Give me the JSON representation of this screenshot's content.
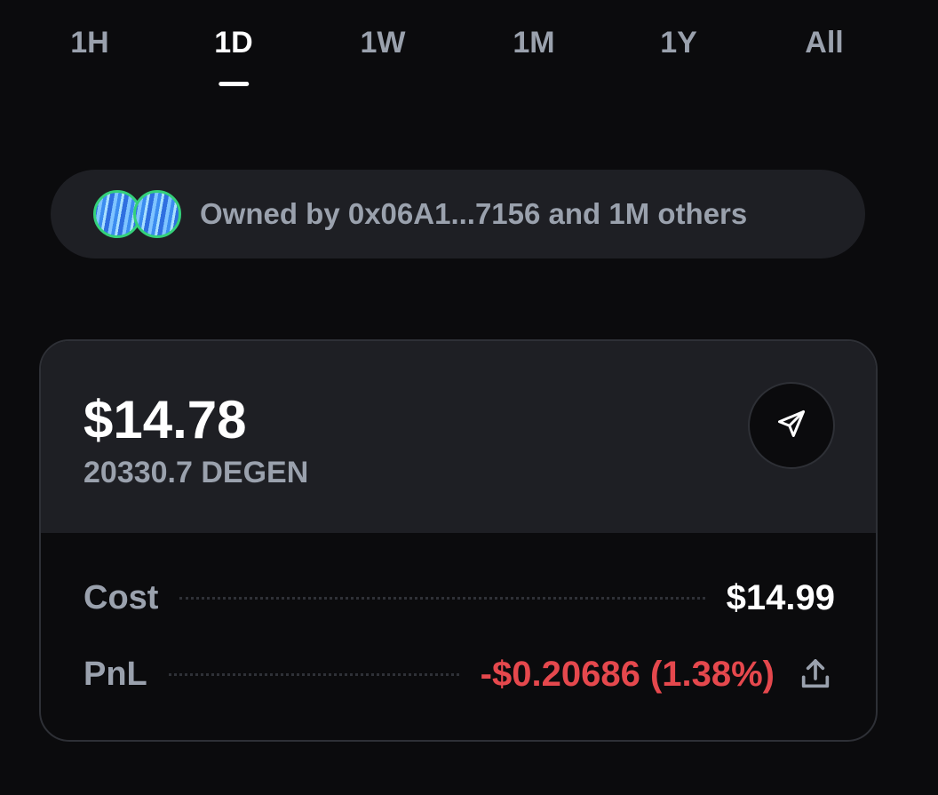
{
  "timeframes": {
    "tabs": [
      {
        "label": "1H"
      },
      {
        "label": "1D"
      },
      {
        "label": "1W"
      },
      {
        "label": "1M"
      },
      {
        "label": "1Y"
      },
      {
        "label": "All"
      }
    ],
    "selected": "1D"
  },
  "owners": {
    "text": "Owned by 0x06A1...7156 and 1M others",
    "avatar_icon": "token-holder-avatar"
  },
  "position": {
    "balance_usd": "$14.78",
    "balance_token": "20330.7 DEGEN",
    "send_icon": "send-paper-plane-icon",
    "cost": {
      "label": "Cost",
      "value": "$14.99"
    },
    "pnl": {
      "label": "PnL",
      "value": "-$0.20686 (1.38%)",
      "share_icon": "share-upload-icon"
    }
  },
  "colors": {
    "background": "#0b0b0d",
    "surface": "#1e1f24",
    "muted_text": "#9aa1ad",
    "negative": "#e5484d",
    "avatar_ring": "#34d07a"
  }
}
